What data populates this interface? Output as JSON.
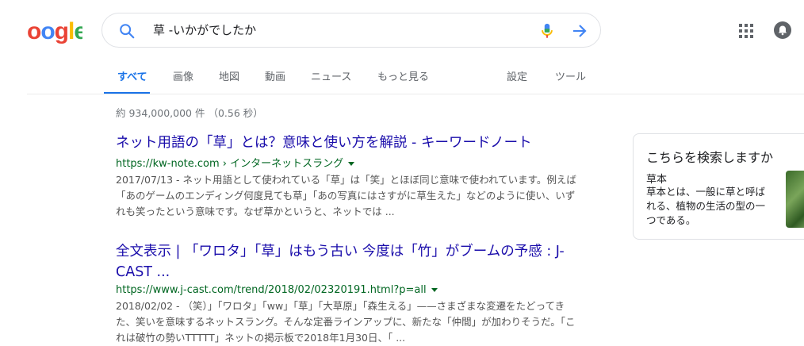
{
  "logo": {
    "text": "oogle"
  },
  "search": {
    "query": "草 -いかがでしたか"
  },
  "tabs": [
    {
      "label": "すべて",
      "active": true
    },
    {
      "label": "画像"
    },
    {
      "label": "地図"
    },
    {
      "label": "動画"
    },
    {
      "label": "ニュース"
    },
    {
      "label": "もっと見る"
    },
    {
      "label": "設定"
    },
    {
      "label": "ツール"
    }
  ],
  "stats": "約 934,000,000 件 （0.56 秒）",
  "results": [
    {
      "title": "ネット用語の「草」とは？意味と使い方を解説 - キーワードノート",
      "url": "https://kw-note.com › インターネットスラング",
      "snippet": "2017/07/13 - ネット用語として使われている「草」は「笑」とほぼ同じ意味で使われています。例えば「あのゲームのエンディング何度見ても草」「あの写真にはさすがに草生えた」などのように使い、いずれも笑ったという意味です。なぜ草かというと、ネットでは ..."
    },
    {
      "title": "全文表示 | 「ワロタ」「草」はもう古い 今度は「竹」がブームの予感 : J-CAST ...",
      "url": "https://www.j-cast.com/trend/2018/02/02320191.html?p=all",
      "snippet": "2018/02/02 - （笑）」「ワロタ」「ww」「草」「大草原」「森生える」——さまざまな変遷をたどってきた、笑いを意味するネットスラング。そんな定番ラインアップに、新たな「仲間」が加わりそうだ。「これは破竹の勢いTTTTT」ネットの掲示板で2018年1月30日、「 ..."
    }
  ],
  "panel": {
    "heading": "こちらを検索しますか",
    "item_title": "草本",
    "item_desc": "草本とは、一般に草と呼ばれる、植物の生活の型の一つである。"
  },
  "colors": {
    "link": "#1a0dab",
    "url": "#006621",
    "accent": "#1a73e8"
  }
}
